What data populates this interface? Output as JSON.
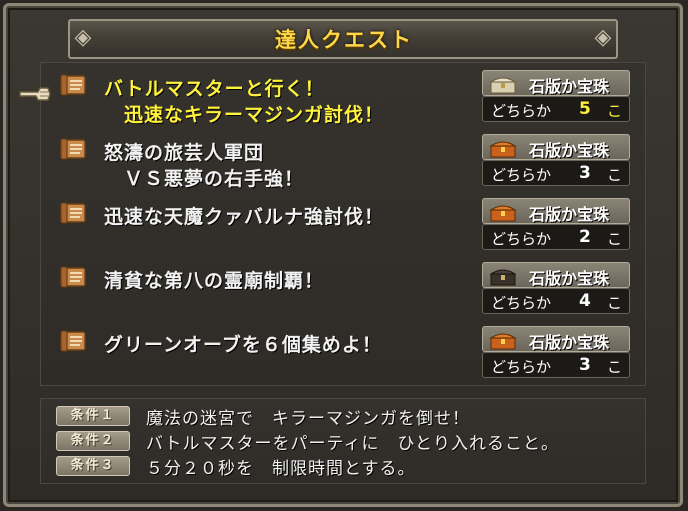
{
  "header": {
    "title": "達人クエスト"
  },
  "quests": [
    {
      "line1": "バトルマスターと行く！",
      "line2": "迅速なキラーマジンガ討伐！",
      "reward": "石版か宝珠",
      "choose": "どちらか",
      "count": "5",
      "unit": "こ",
      "selected": true
    },
    {
      "line1": "怒濤の旅芸人軍団",
      "line2": "ＶＳ悪夢の右手強！",
      "reward": "石版か宝珠",
      "choose": "どちらか",
      "count": "3",
      "unit": "こ",
      "selected": false
    },
    {
      "line1": "迅速な天魔クァバルナ強討伐！",
      "line2": "",
      "reward": "石版か宝珠",
      "choose": "どちらか",
      "count": "2",
      "unit": "こ",
      "selected": false
    },
    {
      "line1": "清貧な第八の霊廟制覇！",
      "line2": "",
      "reward": "石版か宝珠",
      "choose": "どちらか",
      "count": "4",
      "unit": "こ",
      "selected": false
    },
    {
      "line1": "グリーンオーブを６個集めよ！",
      "line2": "",
      "reward": "石版か宝珠",
      "choose": "どちらか",
      "count": "3",
      "unit": "こ",
      "selected": false
    }
  ],
  "conditions": [
    {
      "badge": "条件１",
      "text": "魔法の迷宮で　キラーマジンガを倒せ！"
    },
    {
      "badge": "条件２",
      "text": "バトルマスターをパーティに　ひとり入れること。"
    },
    {
      "badge": "条件３",
      "text": "５分２０秒を　制限時間とする。"
    }
  ],
  "colors": {
    "selected_text": "#fff23c",
    "title": "#ffd84a"
  }
}
